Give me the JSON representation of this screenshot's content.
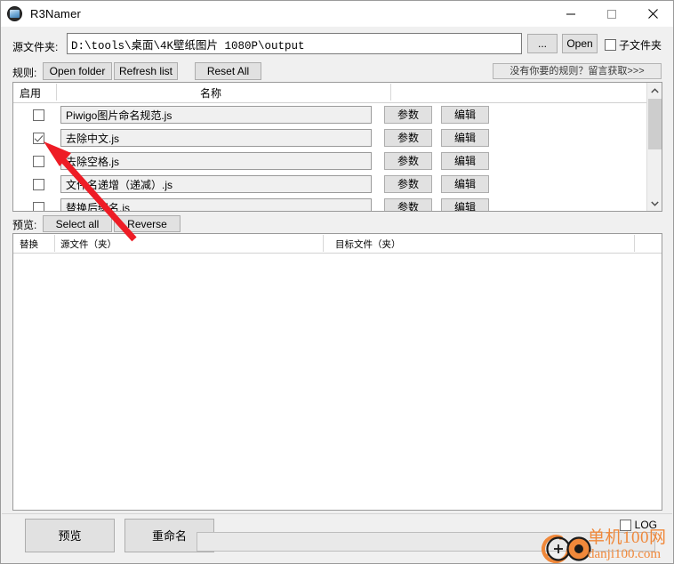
{
  "window": {
    "title": "R3Namer",
    "icon": "app-icon",
    "minimize_label": "—",
    "maximize_label": "□",
    "close_label": "✕"
  },
  "source": {
    "label": "源文件夹:",
    "path": "D:\\tools\\桌面\\4K壁纸图片 1080P\\output",
    "placeholder": "",
    "browse_label": "...",
    "open_label": "Open",
    "subfolder_label": "子文件夹",
    "subfolder_checked": false
  },
  "rules_toolbar": {
    "label": "规则:",
    "open_folder_label": "Open folder",
    "refresh_list_label": "Refresh list",
    "reset_all_label": "Reset All",
    "promo_label": "没有你要的规则？留言获取>>>"
  },
  "rules_table": {
    "col_enable": "启用",
    "col_name": "名称",
    "params_label": "参数",
    "edit_label": "编辑",
    "rows": [
      {
        "enabled": false,
        "name": "Piwigo图片命名规范.js"
      },
      {
        "enabled": true,
        "name": "去除中文.js"
      },
      {
        "enabled": false,
        "name": "去除空格.js"
      },
      {
        "enabled": false,
        "name": "文件名递增（递减）.js"
      },
      {
        "enabled": false,
        "name": "替换后缀名.js"
      }
    ],
    "scroll": {
      "up_arrow": "⌃",
      "down_arrow": "⌄"
    }
  },
  "preview_toolbar": {
    "label": "预览:",
    "select_all_label": "Select all",
    "reverse_label": "Reverse"
  },
  "preview_table": {
    "col_replace": "替换",
    "col_source": "源文件（夹）",
    "col_target": "目标文件（夹）",
    "rows": []
  },
  "bottom": {
    "preview_label": "预览",
    "rename_label": "重命名",
    "status_text": "",
    "log_label": "LOG",
    "log_checked": false
  },
  "watermark": {
    "title": "单机100网",
    "subtitle": "danji100.com",
    "color": "#f0883a"
  },
  "annotation": {
    "arrow_color": "#ee1c25",
    "points_to": "rule-row-1-enable-checkbox"
  }
}
